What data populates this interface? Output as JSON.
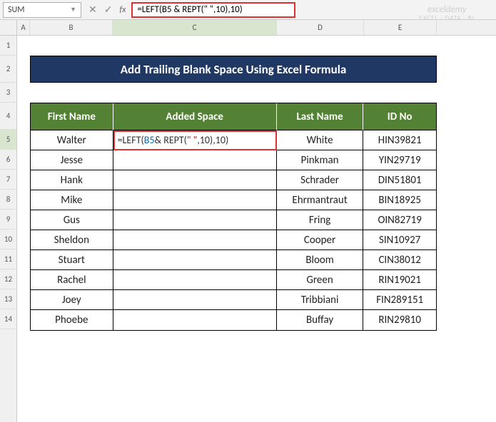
{
  "name_box": "SUM",
  "formula_bar": "=LEFT(B5 & REPT(\" \",10),10)",
  "title": "Add Trailing Blank Space Using Excel Formula",
  "headers": {
    "b": "First Name",
    "c": "Added Space",
    "d": "Last Name",
    "e": "ID No"
  },
  "editing_cell_tokens": {
    "p1": "=LEFT(",
    "ref": "B5",
    "p2": " & REPT(",
    "str": "\" \"",
    "p3": ",",
    "n1": "10",
    "p4": "),",
    "n2": "10",
    "p5": ")"
  },
  "rows": [
    {
      "first": "Walter",
      "last": "White",
      "id": "HIN39821"
    },
    {
      "first": "Jesse",
      "last": "Pinkman",
      "id": "YIN29719"
    },
    {
      "first": "Hank",
      "last": "Schrader",
      "id": "DIN51801"
    },
    {
      "first": "Mike",
      "last": "Ehrmantraut",
      "id": "BIN18925"
    },
    {
      "first": "Gus",
      "last": "Fring",
      "id": "OIN82719"
    },
    {
      "first": "Sheldon",
      "last": "Cooper",
      "id": "SIN10927"
    },
    {
      "first": "Stuart",
      "last": "Bloom",
      "id": "CIN38012"
    },
    {
      "first": "Rachel",
      "last": "Green",
      "id": "RIN19021"
    },
    {
      "first": "Joey",
      "last": "Tribbiani",
      "id": "FIN289151"
    },
    {
      "first": "Phoebe",
      "last": "Buffay",
      "id": "RIN29810"
    }
  ],
  "col_labels": {
    "a": "A",
    "b": "B",
    "c": "C",
    "d": "D",
    "e": "E"
  },
  "row_labels": [
    "1",
    "2",
    "3",
    "4",
    "5",
    "6",
    "7",
    "8",
    "9",
    "10",
    "11",
    "12",
    "13",
    "14"
  ],
  "watermark": {
    "main": "exceldemy",
    "sub": "EXCEL · DATA · BI"
  },
  "chart_data": {
    "type": "table",
    "title": "Add Trailing Blank Space Using Excel Formula",
    "columns": [
      "First Name",
      "Added Space",
      "Last Name",
      "ID No"
    ],
    "formula_in_C5": "=LEFT(B5 & REPT(\" \",10),10)",
    "data": [
      [
        "Walter",
        "",
        "White",
        "HIN39821"
      ],
      [
        "Jesse",
        "",
        "Pinkman",
        "YIN29719"
      ],
      [
        "Hank",
        "",
        "Schrader",
        "DIN51801"
      ],
      [
        "Mike",
        "",
        "Ehrmantraut",
        "BIN18925"
      ],
      [
        "Gus",
        "",
        "Fring",
        "OIN82719"
      ],
      [
        "Sheldon",
        "",
        "Cooper",
        "SIN10927"
      ],
      [
        "Stuart",
        "",
        "Bloom",
        "CIN38012"
      ],
      [
        "Rachel",
        "",
        "Green",
        "RIN19021"
      ],
      [
        "Joey",
        "",
        "Tribbiani",
        "FIN289151"
      ],
      [
        "Phoebe",
        "",
        "Buffay",
        "RIN29810"
      ]
    ]
  }
}
